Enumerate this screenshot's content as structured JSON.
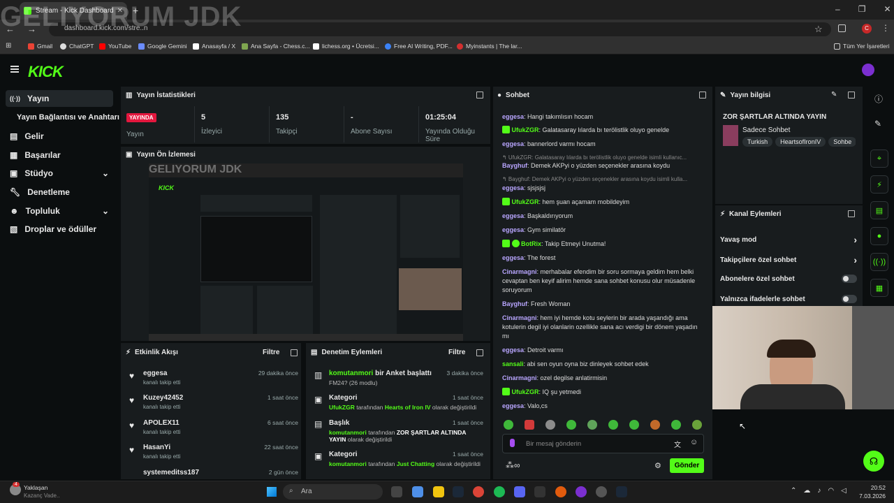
{
  "browser": {
    "tab_title": "Stream - Kick Dashboard",
    "url": "dashboard.kick.com/stre..n",
    "overlay_text": "GELIYORUM JDK",
    "bookmarks": [
      "Gmail",
      "ChatGPT",
      "YouTube",
      "Google Gemini",
      "Anasayfa / X",
      "Ana Sayfa - Chess.c...",
      "lichess.org • Ücretsi...",
      "Free AI Writing, PDF...",
      "Myinstants | The lar..."
    ],
    "bookmarks_all": "Tüm Yer İşaretleri",
    "profile_initial": "C"
  },
  "sidebar": {
    "items": [
      {
        "label": "Yayın",
        "icon": "radio-icon"
      },
      {
        "label": "Yayın Bağlantısı ve Anahtarı"
      },
      {
        "label": "Gelir"
      },
      {
        "label": "Başarılar"
      },
      {
        "label": "Stüdyo"
      },
      {
        "label": "Denetleme"
      },
      {
        "label": "Topluluk"
      },
      {
        "label": "Droplar ve ödüller"
      }
    ]
  },
  "stats": {
    "title": "Yayın İstatistikleri",
    "live_badge": "YAYINDA",
    "live_label": "Yayın",
    "items": [
      {
        "value": "5",
        "label": "İzleyici"
      },
      {
        "value": "135",
        "label": "Takipçi"
      },
      {
        "value": "-",
        "label": "Abone Sayısı"
      },
      {
        "value": "01:25:04",
        "label": "Yayında Olduğu Süre"
      }
    ]
  },
  "preview": {
    "title": "Yayın Ön İzlemesi",
    "overlay": "GELIYORUM JDK"
  },
  "activity": {
    "title": "Etkinlik Akışı",
    "filter": "Filtre",
    "events": [
      {
        "name": "eggesa",
        "sub": "kanalı takip etti",
        "time": "29 dakika önce"
      },
      {
        "name": "Kuzey42452",
        "sub": "kanalı takip etti",
        "time": "1 saat önce"
      },
      {
        "name": "APOLEX11",
        "sub": "kanalı takip etti",
        "time": "6 saat önce"
      },
      {
        "name": "HasanYi",
        "sub": "kanalı takip etti",
        "time": "22 saat önce"
      },
      {
        "name": "systemeditss187",
        "sub": "",
        "time": "2 gün önce"
      }
    ]
  },
  "moderation": {
    "title": "Denetim Eylemleri",
    "filter": "Filtre",
    "events": [
      {
        "title_user": "komutanmori",
        "title_rest": " bir Anket başlattı",
        "sub": "FM24? (26 modlu)",
        "time": "3 dakika önce"
      },
      {
        "title_user": "",
        "title_rest": "Kategori",
        "sub_user": "UfukZGR",
        "sub_mid": " tarafından ",
        "sub_em": "Hearts of Iron IV",
        "sub_end": " olarak değiştirildi",
        "time": "1 saat önce"
      },
      {
        "title_user": "",
        "title_rest": "Başlık",
        "sub_user": "komutanmori",
        "sub_mid": " tarafından ",
        "sub_em": "ZOR ŞARTLAR ALTINDA YAYIN",
        "sub_end": " olarak değiştirildi",
        "time": "1 saat önce"
      },
      {
        "title_user": "",
        "title_rest": "Kategori",
        "sub_user": "komutanmori",
        "sub_mid": " tarafından ",
        "sub_em": "Just Chatting",
        "sub_end": " olarak değiştirildi",
        "time": "1 saat önce"
      }
    ]
  },
  "chat": {
    "title": "Sohbet",
    "placeholder": "Bir mesaj gönderin",
    "send": "Gönder",
    "messages": [
      {
        "user": "eggesa",
        "color": "#b9a6ff",
        "text": "Hangi takımlısın hocam"
      },
      {
        "user": "UfukZGR",
        "color": "#53fc18",
        "text": "Galatasaray lılarda bı terölistlik oluyo genelde",
        "badge": true
      },
      {
        "user": "eggesa",
        "color": "#b9a6ff",
        "text": "bannerlord varmı hocam"
      },
      {
        "reply": "↰ UfukZGR: Galatasaray lılarda bı terölistlik oluyo genelde isimli kullanıc..."
      },
      {
        "user": "Bayghuf",
        "color": "#b9a6ff",
        "text": "Demek AKPyi o yüzden seçenekler arasına koydu"
      },
      {
        "reply": "↰ Bayghuf: Demek AKPyi o yüzden seçenekler arasına koydu isimli kulla..."
      },
      {
        "user": "eggesa",
        "color": "#b9a6ff",
        "text": "sjsjsjsj"
      },
      {
        "user": "UfukZGR",
        "color": "#53fc18",
        "text": "hem şuan açamam mobildeyim",
        "badge": true
      },
      {
        "user": "eggesa",
        "color": "#b9a6ff",
        "text": "Başkaldırıyorum"
      },
      {
        "user": "eggesa",
        "color": "#b9a6ff",
        "text": "Gym similatör"
      },
      {
        "user": "BotRix",
        "color": "#53fc18",
        "text": "Takip Etmeyi Unutma!",
        "badge": true
      },
      {
        "user": "eggesa",
        "color": "#b9a6ff",
        "text": "The forest"
      },
      {
        "user": "Cinarmagni",
        "color": "#b9a6ff",
        "text": "merhabalar efendim bir soru sormaya geldim hem belki cevaptan ben keyif alirim hemde sana sohbet konusu olur müsadenle soruyorum"
      },
      {
        "user": "Bayghuf",
        "color": "#b9a6ff",
        "text": "Fresh Woman"
      },
      {
        "user": "Cinarmagni",
        "color": "#b9a6ff",
        "text": "hem iyi hemde kotu seylerin bir arada yaşandığı ama kotulerin degil iyi olanlarin ozellikle sana acı verdigi bir dönem yaşadın mı"
      },
      {
        "user": "eggesa",
        "color": "#b9a6ff",
        "text": "Detroit varmı"
      },
      {
        "user": "sansali",
        "color": "#53fc18",
        "text": "abi sen oyun oyna biz dinleyek sohbet edek"
      },
      {
        "user": "Cinarmagni",
        "color": "#b9a6ff",
        "text": "ozel degilse anlatirmisin"
      },
      {
        "user": "UfukZGR",
        "color": "#53fc18",
        "text": "IQ şu yetmedi",
        "badge": true
      },
      {
        "user": "eggesa",
        "color": "#b9a6ff",
        "text": "Valo,cs"
      }
    ]
  },
  "stream_info": {
    "title": "Yayın bilgisi",
    "stream_title": "ZOR ŞARTLAR ALTINDA YAYIN",
    "category": "Sadece Sohbet",
    "tags": [
      "Turkish",
      "HeartsofIronIV",
      "Sohbe"
    ]
  },
  "channel_actions": {
    "title": "Kanal Eylemleri",
    "items": [
      {
        "label": "Yavaş mod",
        "type": "chevron"
      },
      {
        "label": "Takipçilere özel sohbet",
        "type": "chevron"
      },
      {
        "label": "Abonelere özel sohbet",
        "type": "toggle"
      },
      {
        "label": "Yalnızca ifadelerle sohbet",
        "type": "toggle"
      }
    ]
  },
  "taskbar": {
    "weather": "Yaklaşan",
    "weather_sub": "Kazanç Vade..",
    "badge": "4",
    "search": "Ara",
    "time": "20:52",
    "date": "7.03.2026"
  },
  "colors": {
    "accent": "#53fc18",
    "live": "#e3173e",
    "panel": "#181c1e"
  }
}
